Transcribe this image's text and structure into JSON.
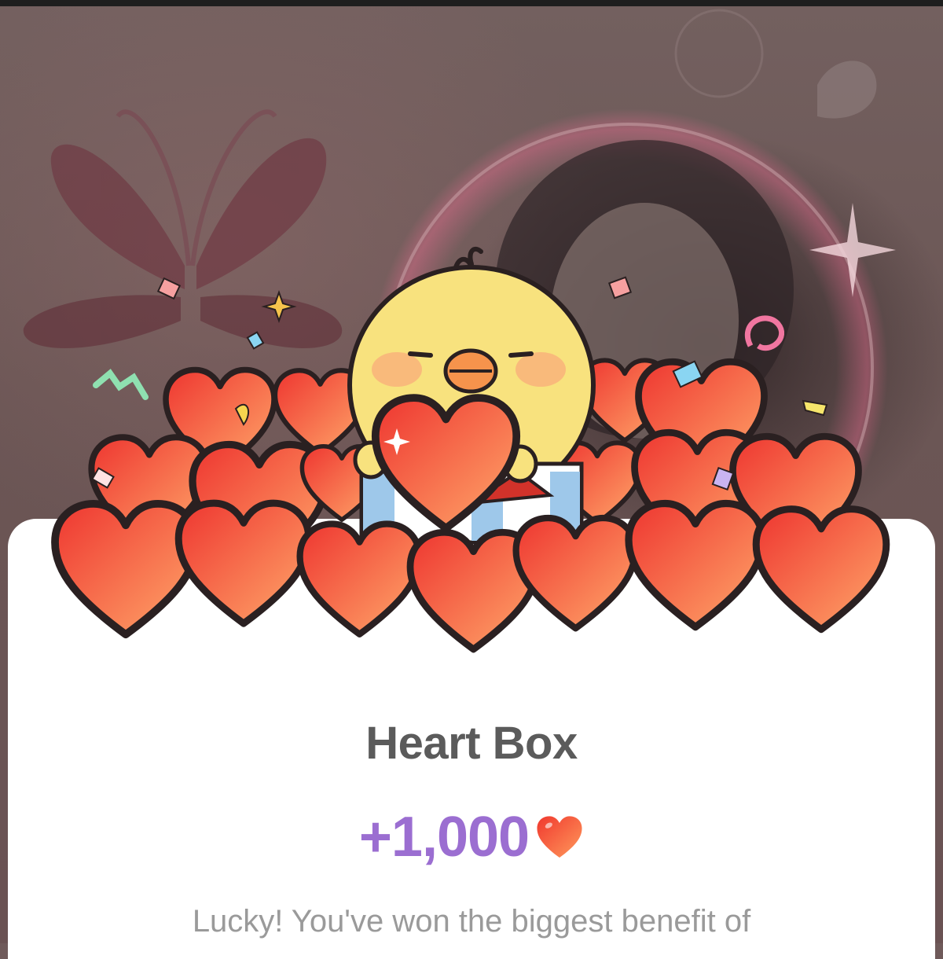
{
  "popup": {
    "title": "Heart Box",
    "reward_amount": "+1,000",
    "reward_icon": "heart-icon",
    "message": "Lucky! You've won the biggest benefit of"
  },
  "colors": {
    "title": "#5b5b5b",
    "reward": "#9b6ed1",
    "message": "#9a9a9a",
    "heart": "#f4553a",
    "chick": "#f8e27e"
  }
}
